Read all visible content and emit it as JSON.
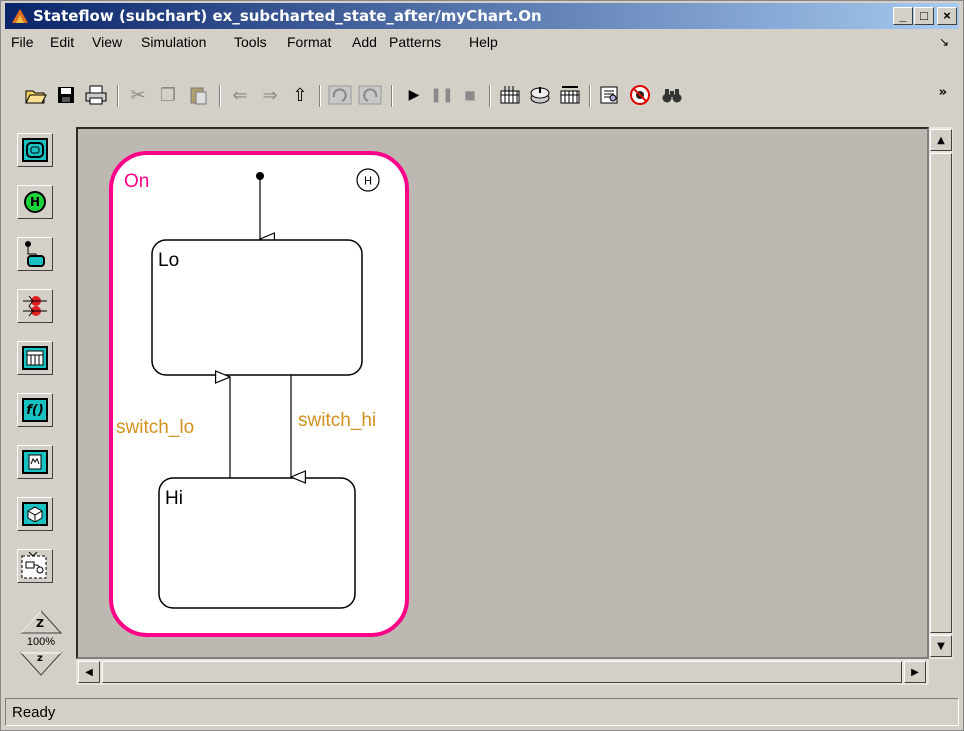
{
  "window": {
    "title": "Stateflow (subchart) ex_subcharted_state_after/myChart.On",
    "buttons": {
      "minimize": "_",
      "maximize": "□",
      "close": "×"
    }
  },
  "menubar": {
    "items": [
      "File",
      "Edit",
      "View",
      "Simulation",
      "Tools",
      "Format",
      "Add",
      "Patterns",
      "Help"
    ]
  },
  "toolbar": {
    "icons": [
      "open-folder-icon",
      "save-icon",
      "print-icon",
      "cut-icon",
      "copy-icon",
      "paste-icon",
      "back-arrow-icon",
      "forward-arrow-icon",
      "up-arrow-icon",
      "undo-icon",
      "redo-icon",
      "play-icon",
      "pause-icon",
      "stop-icon",
      "build-icon",
      "incremental-build-icon",
      "rebuild-icon",
      "explorer-icon",
      "debugger-icon",
      "find-icon"
    ],
    "overflow": "»"
  },
  "palette": {
    "tools": [
      "state-tool-icon",
      "history-junction-tool-icon",
      "default-transition-tool-icon",
      "connective-junction-tool-icon",
      "truth-table-tool-icon",
      "graphical-function-tool-icon",
      "embedded-matlab-function-tool-icon",
      "box-tool-icon",
      "simulink-function-tool-icon"
    ],
    "history_label": "H",
    "function_label": "f()",
    "zoom_in_label": "Z",
    "zoom_level": "100%",
    "zoom_out_label": "z"
  },
  "diagram": {
    "superstate": {
      "name": "On",
      "history_junction": "H",
      "color": "#ff0088"
    },
    "states": [
      {
        "name": "Lo"
      },
      {
        "name": "Hi"
      }
    ],
    "transitions": [
      {
        "label": "switch_lo",
        "from": "Hi",
        "to": "Lo",
        "color": "#d49020"
      },
      {
        "label": "switch_hi",
        "from": "Lo",
        "to": "Hi",
        "color": "#d49020"
      }
    ]
  },
  "status": {
    "text": "Ready"
  }
}
